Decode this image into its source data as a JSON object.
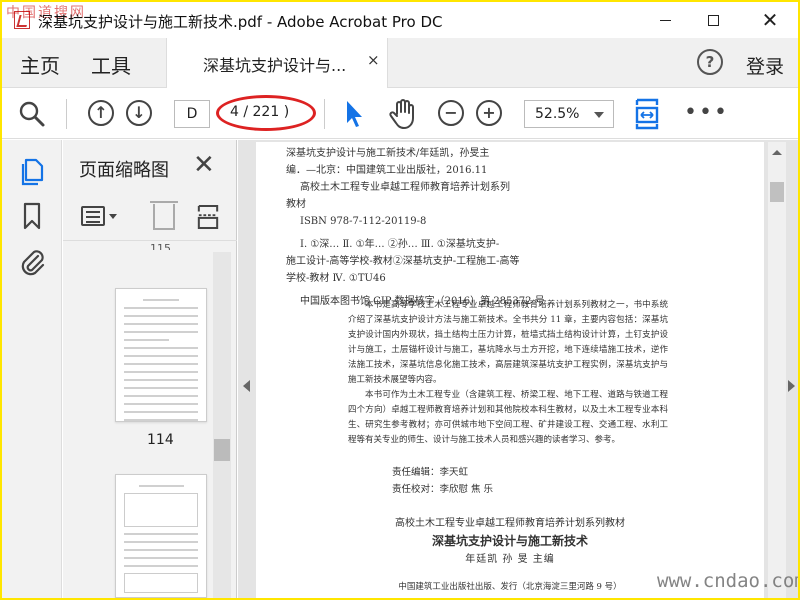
{
  "window": {
    "title": "深基坑支护设计与施工新技术.pdf - Adobe Acrobat Pro DC",
    "watermark_top": "中国道搜网",
    "minimize": "—",
    "maximize": "□",
    "close": "✕"
  },
  "tabbar": {
    "home": "主页",
    "tools": "工具",
    "doc_tab": "深基坑支护设计与...",
    "doc_tab_close": "×",
    "help": "?",
    "login": "登录"
  },
  "toolbar": {
    "page_input": "D",
    "page_count": "4 / 221 )",
    "zoom": "52.5%",
    "more": "•••",
    "colors": {
      "accent": "#1473e6",
      "highlight": "#dd2222"
    }
  },
  "thumbnails": {
    "title": "页面缩略图",
    "close": "✕",
    "partial_label": "115",
    "pages": [
      {
        "label": "114"
      },
      {
        "label": ""
      }
    ]
  },
  "page": {
    "cip": {
      "line1": "深基坑支护设计与施工新技术/年廷凯，孙旻主",
      "line2": "编．—北京：中国建筑工业出版社，2016.11",
      "line3": "高校土木工程专业卓越工程师教育培养计划系列",
      "line4": "教材",
      "isbn": "ISBN 978-7-112-20119-8",
      "class1": "Ⅰ. ①深…  Ⅱ. ①年…  ②孙…  Ⅲ. ①深基坑支护-",
      "class2": "施工设计-高等学校-教材②深基坑支护-工程施工-高等",
      "class3": "学校-教材  Ⅳ. ①TU46",
      "cip_number": "中国版本图书馆 CIP 数据核字（2016）第 285372 号"
    },
    "abstract": {
      "p1": "本书是高等学校土木工程专业卓越工程师教育培养计划系列教材之一，书中系统介绍了深基坑支护设计方法与施工新技术。全书共分 11 章，主要内容包括：深基坑支护设计国内外现状，挡土结构土压力计算，桩墙式挡土结构设计计算，土钉支护设计与施工，土层锚杆设计与施工，基坑降水与土方开挖，地下连续墙施工技术，逆作法施工技术，深基坑信息化施工技术，高层建筑深基坑支护工程实例，深基坑支护与施工新技术展望等内容。",
      "p2": "本书可作为土木工程专业（含建筑工程、桥梁工程、地下工程、道路与铁道工程四个方向）卓越工程师教育培养计划和其他院校本科生教材，以及土木工程专业本科生、研究生参考教材；亦可供城市地下空间工程、矿井建设工程、交通工程、水利工程等有关专业的师生、设计与施工技术人员和感兴趣的读者学习、参考。"
    },
    "editors": {
      "editor": "责任编辑：李天虹",
      "proofreader": "责任校对：李欣慰  焦  乐"
    },
    "series": "高校土木工程专业卓越工程师教育培养计划系列教材",
    "book_title": "深基坑支护设计与施工新技术",
    "authors": "年廷凯  孙  旻  主编",
    "publisher": "中国建筑工业出版社出版、发行（北京海淀三里河路 9 号）"
  },
  "watermark_bottom": "www.cndao.com"
}
